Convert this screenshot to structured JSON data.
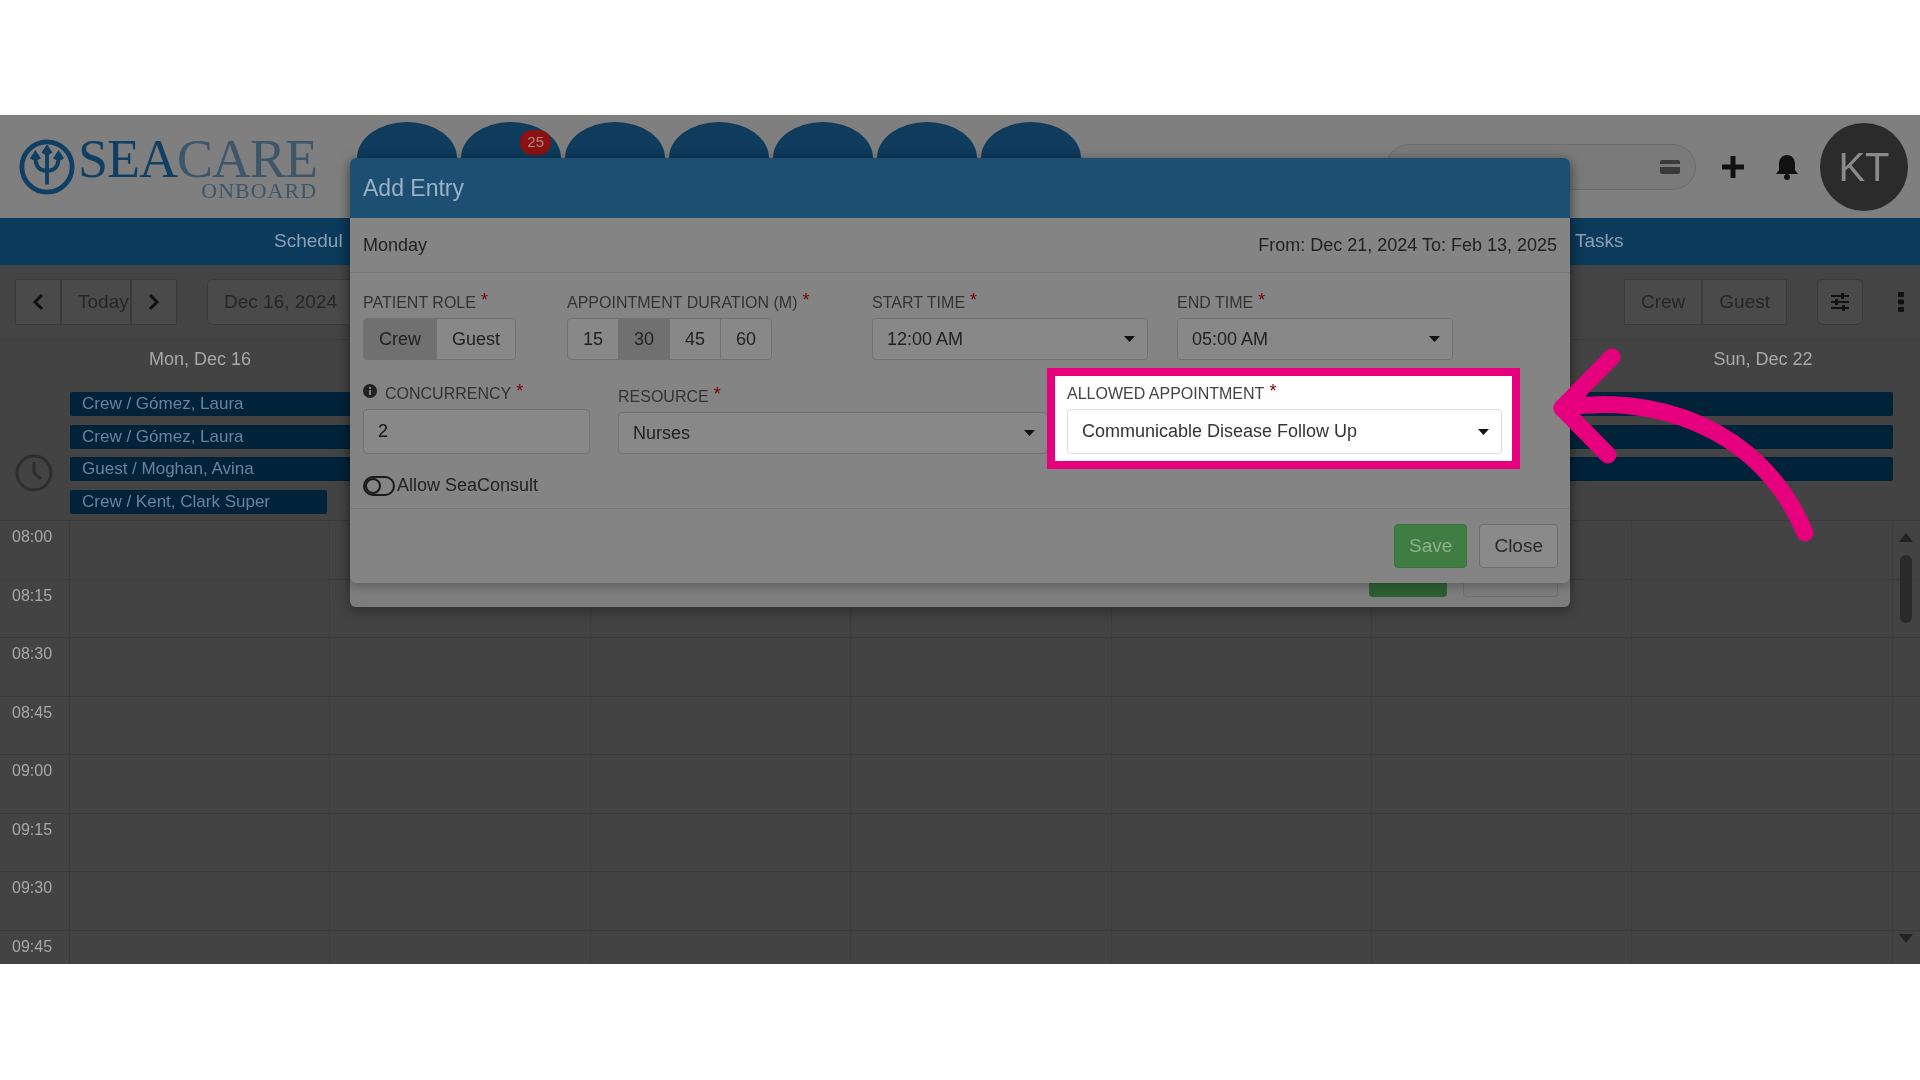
{
  "header": {
    "logo": {
      "primary": "SEA",
      "secondary": "CARE",
      "tagline": "ONBOARD"
    },
    "nav_badge": "25",
    "avatar": "KT"
  },
  "tab_bar": {
    "items": [
      "Schedul",
      "Tasks"
    ]
  },
  "toolbar": {
    "today": "Today",
    "date_range": "Dec 16, 2024",
    "role_filters": [
      "Crew",
      "Guest"
    ]
  },
  "calendar": {
    "first_day": "Mon, Dec 16",
    "last_day": "Sun, Dec 22",
    "events": [
      {
        "label": "Crew / Gómez, Laura",
        "kind": "multi-day"
      },
      {
        "label": "Crew / Gómez, Laura",
        "kind": "multi-day"
      },
      {
        "label": "Guest / Moghan, Avina",
        "kind": "multi-day"
      },
      {
        "label": "Crew / Kent, Clark Super",
        "kind": "single-day"
      }
    ],
    "times": [
      "08:00",
      "08:15",
      "08:30",
      "08:45",
      "09:00",
      "09:15",
      "09:30",
      "09:45"
    ]
  },
  "dialog": {
    "title": "Add Entry",
    "day": "Monday",
    "range": "From: Dec 21, 2024 To: Feb 13, 2025",
    "rows": [
      {
        "fields": [
          {
            "kind": "segmented",
            "label": "PATIENT ROLE",
            "required_mark": "*",
            "options": [
              {
                "label": "Crew",
                "selected": true
              },
              {
                "label": "Guest",
                "selected": false
              }
            ]
          },
          {
            "kind": "segmented",
            "label": "APPOINTMENT DURATION (M)",
            "required_mark": "*",
            "options": [
              {
                "label": "15",
                "selected": false
              },
              {
                "label": "30",
                "selected": true
              },
              {
                "label": "45",
                "selected": false
              },
              {
                "label": "60",
                "selected": false
              }
            ]
          },
          {
            "kind": "select",
            "label": "START TIME",
            "required_mark": "*",
            "value": "12:00 AM",
            "highlighted": false
          },
          {
            "kind": "select",
            "label": "END TIME",
            "required_mark": "*",
            "value": "05:00 AM",
            "highlighted": false
          }
        ]
      },
      {
        "fields": [
          {
            "kind": "input",
            "label": "CONCURRENCY",
            "required_mark": "*",
            "value": "2",
            "info": true
          },
          {
            "kind": "select",
            "label": "RESOURCE",
            "required_mark": "*",
            "value": "Nurses",
            "highlighted": false
          },
          {
            "kind": "select",
            "label": "ALLOWED APPOINTMENT",
            "required_mark": "*",
            "value": "Communicable Disease Follow Up",
            "highlighted": true
          }
        ]
      },
      {
        "fields": [
          {
            "kind": "toggle",
            "label": "Allow SeaConsult",
            "on": false
          }
        ]
      }
    ],
    "buttons": [
      {
        "label": "Save",
        "kind": "primary"
      },
      {
        "label": "Close",
        "kind": "secondary"
      }
    ]
  }
}
